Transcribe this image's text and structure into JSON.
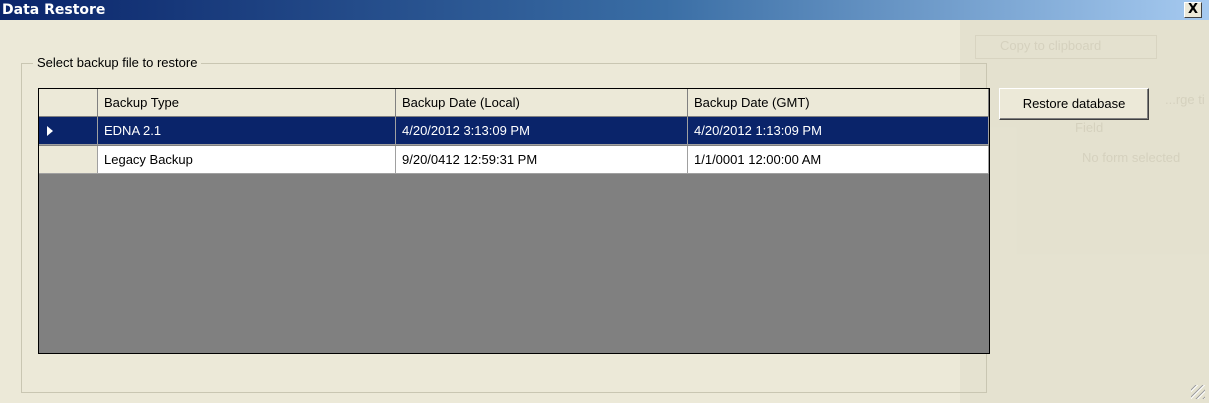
{
  "window": {
    "title": "Data Restore",
    "close_label": "X"
  },
  "background_ghost": {
    "copy_label": "Copy to clipboard",
    "merge_label": "...rge ti",
    "field_label": "Field",
    "no_form_label": "No form selected"
  },
  "group": {
    "legend": "Select backup file to restore"
  },
  "grid": {
    "columns": [
      "Backup Type",
      "Backup Date (Local)",
      "Backup Date (GMT)"
    ],
    "rows": [
      {
        "type": "EDNA 2.1",
        "local": "4/20/2012 3:13:09 PM",
        "gmt": "4/20/2012 1:13:09 PM",
        "selected": true
      },
      {
        "type": "Legacy Backup",
        "local": "9/20/0412 12:59:31 PM",
        "gmt": "1/1/0001 12:00:00 AM",
        "selected": false
      }
    ]
  },
  "actions": {
    "restore_label": "Restore database"
  },
  "colors": {
    "title_start": "#0a246a",
    "selection": "#0a246a",
    "grid_background": "#808080",
    "window_face": "#ece9d8"
  }
}
